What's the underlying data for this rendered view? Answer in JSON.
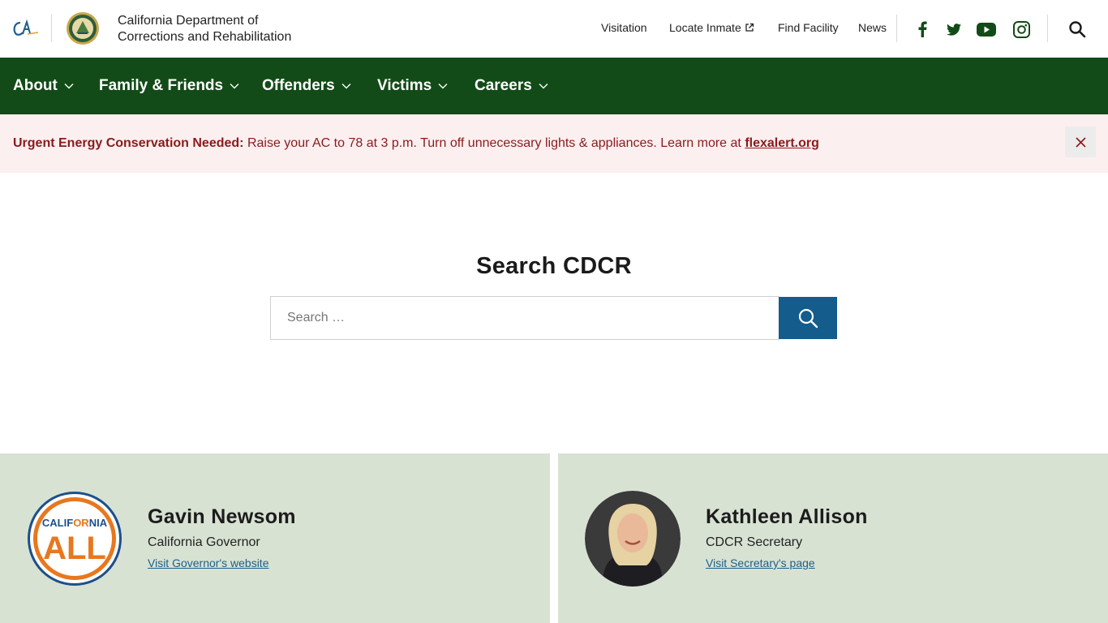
{
  "header": {
    "org_line1": "California Department of",
    "org_line2": "Corrections and Rehabilitation",
    "utility_links": [
      {
        "label": "Visitation"
      },
      {
        "label": "Locate Inmate"
      },
      {
        "label": "Find Facility"
      },
      {
        "label": "News"
      }
    ],
    "social_icons": [
      "facebook-icon",
      "twitter-icon",
      "youtube-icon",
      "instagram-icon"
    ],
    "brand_green": "#124b17"
  },
  "nav": {
    "items": [
      {
        "label": "About"
      },
      {
        "label": "Family & Friends"
      },
      {
        "label": "Offenders"
      },
      {
        "label": "Victims"
      },
      {
        "label": "Careers"
      }
    ]
  },
  "alert": {
    "heading": "Urgent Energy Conservation Needed:",
    "message": " Raise your AC to 78 at 3 p.m. Turn off unnecessary lights & appliances. Learn more at ",
    "link_text": "flexalert.org",
    "color": "#8a1b1b",
    "background": "#fceff0"
  },
  "search": {
    "title": "Search CDCR",
    "placeholder": "Search …",
    "button_color": "#135c8c"
  },
  "cards": [
    {
      "badge_line1_a": "CALIF",
      "badge_line1_b": "OR",
      "badge_line1_c": "NIA",
      "badge_line2": "ALL",
      "name": "Gavin Newsom",
      "role": "California Governor",
      "link": "Visit Governor's website"
    },
    {
      "name": "Kathleen Allison",
      "role": "CDCR Secretary",
      "link": "Visit Secretary's page"
    }
  ]
}
